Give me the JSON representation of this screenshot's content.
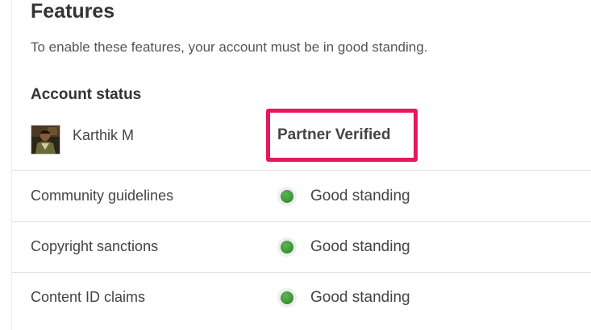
{
  "features": {
    "title": "Features",
    "subtitle": "To enable these features, your account must be in good standing."
  },
  "account_status": {
    "heading": "Account status",
    "account_name": "Karthik M",
    "partner_label": "Partner Verified",
    "highlight_color": "#e8175d"
  },
  "status_rows": [
    {
      "label": "Community guidelines",
      "status": "Good standing",
      "status_color": "#3f9a3a"
    },
    {
      "label": "Copyright sanctions",
      "status": "Good standing",
      "status_color": "#3f9a3a"
    },
    {
      "label": "Content ID claims",
      "status": "Good standing",
      "status_color": "#3f9a3a"
    }
  ]
}
